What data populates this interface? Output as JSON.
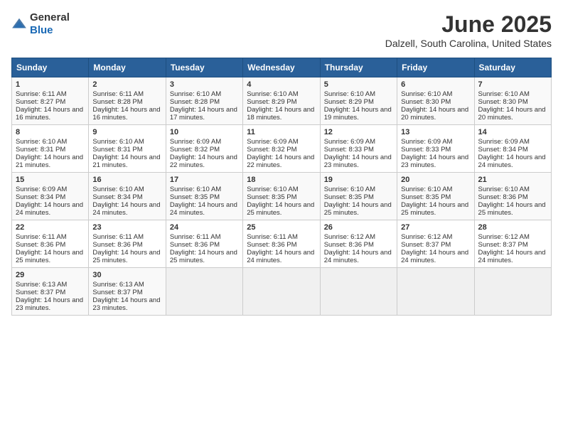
{
  "logo": {
    "text_general": "General",
    "text_blue": "Blue"
  },
  "title": "June 2025",
  "subtitle": "Dalzell, South Carolina, United States",
  "days_of_week": [
    "Sunday",
    "Monday",
    "Tuesday",
    "Wednesday",
    "Thursday",
    "Friday",
    "Saturday"
  ],
  "weeks": [
    [
      {
        "day": "1",
        "sunrise": "Sunrise: 6:11 AM",
        "sunset": "Sunset: 8:27 PM",
        "daylight": "Daylight: 14 hours and 16 minutes."
      },
      {
        "day": "2",
        "sunrise": "Sunrise: 6:11 AM",
        "sunset": "Sunset: 8:28 PM",
        "daylight": "Daylight: 14 hours and 16 minutes."
      },
      {
        "day": "3",
        "sunrise": "Sunrise: 6:10 AM",
        "sunset": "Sunset: 8:28 PM",
        "daylight": "Daylight: 14 hours and 17 minutes."
      },
      {
        "day": "4",
        "sunrise": "Sunrise: 6:10 AM",
        "sunset": "Sunset: 8:29 PM",
        "daylight": "Daylight: 14 hours and 18 minutes."
      },
      {
        "day": "5",
        "sunrise": "Sunrise: 6:10 AM",
        "sunset": "Sunset: 8:29 PM",
        "daylight": "Daylight: 14 hours and 19 minutes."
      },
      {
        "day": "6",
        "sunrise": "Sunrise: 6:10 AM",
        "sunset": "Sunset: 8:30 PM",
        "daylight": "Daylight: 14 hours and 20 minutes."
      },
      {
        "day": "7",
        "sunrise": "Sunrise: 6:10 AM",
        "sunset": "Sunset: 8:30 PM",
        "daylight": "Daylight: 14 hours and 20 minutes."
      }
    ],
    [
      {
        "day": "8",
        "sunrise": "Sunrise: 6:10 AM",
        "sunset": "Sunset: 8:31 PM",
        "daylight": "Daylight: 14 hours and 21 minutes."
      },
      {
        "day": "9",
        "sunrise": "Sunrise: 6:10 AM",
        "sunset": "Sunset: 8:31 PM",
        "daylight": "Daylight: 14 hours and 21 minutes."
      },
      {
        "day": "10",
        "sunrise": "Sunrise: 6:09 AM",
        "sunset": "Sunset: 8:32 PM",
        "daylight": "Daylight: 14 hours and 22 minutes."
      },
      {
        "day": "11",
        "sunrise": "Sunrise: 6:09 AM",
        "sunset": "Sunset: 8:32 PM",
        "daylight": "Daylight: 14 hours and 22 minutes."
      },
      {
        "day": "12",
        "sunrise": "Sunrise: 6:09 AM",
        "sunset": "Sunset: 8:33 PM",
        "daylight": "Daylight: 14 hours and 23 minutes."
      },
      {
        "day": "13",
        "sunrise": "Sunrise: 6:09 AM",
        "sunset": "Sunset: 8:33 PM",
        "daylight": "Daylight: 14 hours and 23 minutes."
      },
      {
        "day": "14",
        "sunrise": "Sunrise: 6:09 AM",
        "sunset": "Sunset: 8:34 PM",
        "daylight": "Daylight: 14 hours and 24 minutes."
      }
    ],
    [
      {
        "day": "15",
        "sunrise": "Sunrise: 6:09 AM",
        "sunset": "Sunset: 8:34 PM",
        "daylight": "Daylight: 14 hours and 24 minutes."
      },
      {
        "day": "16",
        "sunrise": "Sunrise: 6:10 AM",
        "sunset": "Sunset: 8:34 PM",
        "daylight": "Daylight: 14 hours and 24 minutes."
      },
      {
        "day": "17",
        "sunrise": "Sunrise: 6:10 AM",
        "sunset": "Sunset: 8:35 PM",
        "daylight": "Daylight: 14 hours and 24 minutes."
      },
      {
        "day": "18",
        "sunrise": "Sunrise: 6:10 AM",
        "sunset": "Sunset: 8:35 PM",
        "daylight": "Daylight: 14 hours and 25 minutes."
      },
      {
        "day": "19",
        "sunrise": "Sunrise: 6:10 AM",
        "sunset": "Sunset: 8:35 PM",
        "daylight": "Daylight: 14 hours and 25 minutes."
      },
      {
        "day": "20",
        "sunrise": "Sunrise: 6:10 AM",
        "sunset": "Sunset: 8:35 PM",
        "daylight": "Daylight: 14 hours and 25 minutes."
      },
      {
        "day": "21",
        "sunrise": "Sunrise: 6:10 AM",
        "sunset": "Sunset: 8:36 PM",
        "daylight": "Daylight: 14 hours and 25 minutes."
      }
    ],
    [
      {
        "day": "22",
        "sunrise": "Sunrise: 6:11 AM",
        "sunset": "Sunset: 8:36 PM",
        "daylight": "Daylight: 14 hours and 25 minutes."
      },
      {
        "day": "23",
        "sunrise": "Sunrise: 6:11 AM",
        "sunset": "Sunset: 8:36 PM",
        "daylight": "Daylight: 14 hours and 25 minutes."
      },
      {
        "day": "24",
        "sunrise": "Sunrise: 6:11 AM",
        "sunset": "Sunset: 8:36 PM",
        "daylight": "Daylight: 14 hours and 25 minutes."
      },
      {
        "day": "25",
        "sunrise": "Sunrise: 6:11 AM",
        "sunset": "Sunset: 8:36 PM",
        "daylight": "Daylight: 14 hours and 24 minutes."
      },
      {
        "day": "26",
        "sunrise": "Sunrise: 6:12 AM",
        "sunset": "Sunset: 8:36 PM",
        "daylight": "Daylight: 14 hours and 24 minutes."
      },
      {
        "day": "27",
        "sunrise": "Sunrise: 6:12 AM",
        "sunset": "Sunset: 8:37 PM",
        "daylight": "Daylight: 14 hours and 24 minutes."
      },
      {
        "day": "28",
        "sunrise": "Sunrise: 6:12 AM",
        "sunset": "Sunset: 8:37 PM",
        "daylight": "Daylight: 14 hours and 24 minutes."
      }
    ],
    [
      {
        "day": "29",
        "sunrise": "Sunrise: 6:13 AM",
        "sunset": "Sunset: 8:37 PM",
        "daylight": "Daylight: 14 hours and 23 minutes."
      },
      {
        "day": "30",
        "sunrise": "Sunrise: 6:13 AM",
        "sunset": "Sunset: 8:37 PM",
        "daylight": "Daylight: 14 hours and 23 minutes."
      },
      null,
      null,
      null,
      null,
      null
    ]
  ]
}
